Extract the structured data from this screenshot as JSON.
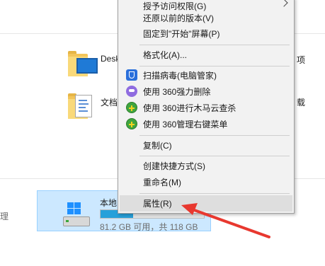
{
  "explorer": {
    "right_partial_top": "项",
    "right_partial_mid": "载",
    "left_partial": "理",
    "folders": [
      {
        "name": "Desk",
        "icon": "desktop-folder-icon"
      },
      {
        "name": "文档",
        "icon": "documents-folder-icon"
      }
    ],
    "drive": {
      "name": "本地",
      "free_text": "81.2 GB 可用，共 118 GB",
      "used_fraction": 0.312,
      "icon": "windows-drive-icon"
    }
  },
  "context_menu": {
    "items": [
      {
        "label": "授予访问权限(G)",
        "icon": "",
        "submenu": true
      },
      {
        "label": "还原以前的版本(V)",
        "icon": ""
      },
      {
        "label": "固定到\"开始\"屏幕(P)",
        "icon": ""
      },
      {
        "label": "格式化(A)...",
        "icon": ""
      },
      {
        "label": "扫描病毒(电脑管家)",
        "icon": "tencent-shield-icon"
      },
      {
        "label": "使用 360强力删除",
        "icon": "360-robot-icon"
      },
      {
        "label": "使用 360进行木马云查杀",
        "icon": "360-plus-icon"
      },
      {
        "label": "使用 360管理右键菜单",
        "icon": "360-plus-icon"
      },
      {
        "label": "复制(C)",
        "icon": ""
      },
      {
        "label": "创建快捷方式(S)",
        "icon": ""
      },
      {
        "label": "重命名(M)",
        "icon": ""
      },
      {
        "label": "属性(R)",
        "icon": "",
        "highlighted": true
      }
    ]
  },
  "colors": {
    "selection_bg": "#cce8ff",
    "menu_bg": "#f2f2f2",
    "highlight_bg": "#dedede",
    "arrow": "#e8382f"
  }
}
